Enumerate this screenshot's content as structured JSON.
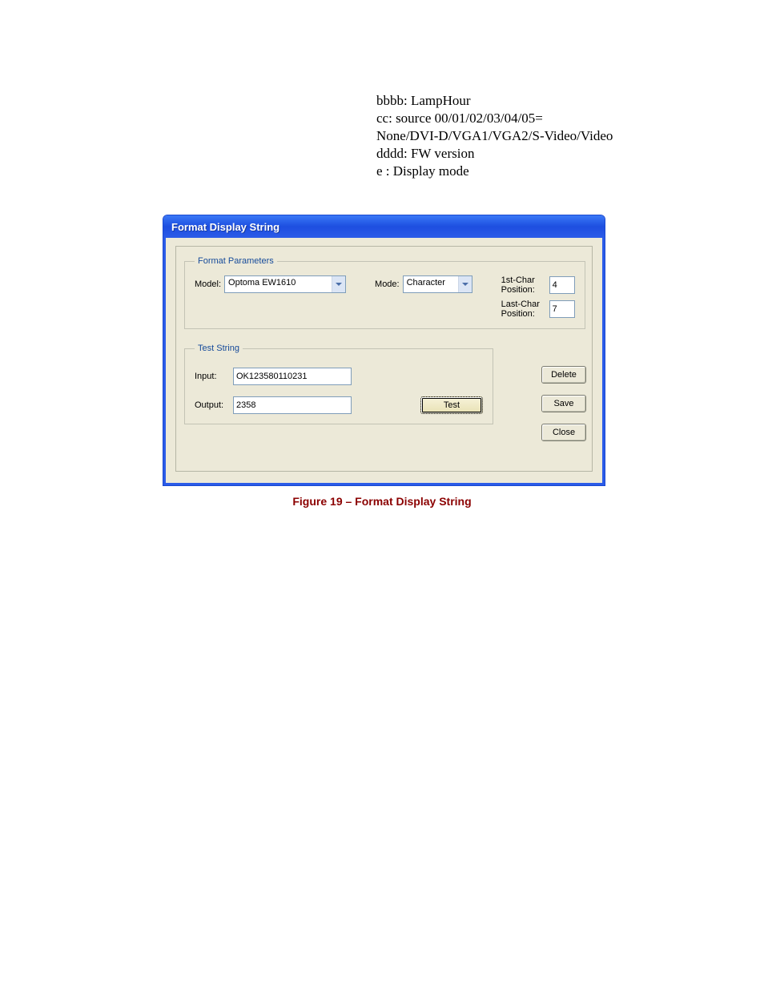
{
  "header": {
    "line1": "bbbb: LampHour",
    "line2": "cc: source 00/01/02/03/04/05=",
    "line3": "None/DVI-D/VGA1/VGA2/S-Video/Video",
    "line4": "dddd: FW version",
    "line5": "e : Display mode"
  },
  "window": {
    "title": "Format Display String"
  },
  "formatParams": {
    "legend": "Format Parameters",
    "modelLabel": "Model:",
    "modelValue": "Optoma EW1610",
    "modeLabel": "Mode:",
    "modeValue": "Character",
    "firstCharLabel": "1st-Char Position:",
    "firstCharValue": "4",
    "lastCharLabel": "Last-Char Position:",
    "lastCharValue": "7"
  },
  "testString": {
    "legend": "Test String",
    "inputLabel": "Input:",
    "inputValue": "OK123580110231",
    "outputLabel": "Output:",
    "outputValue": "2358",
    "testButton": "Test"
  },
  "buttons": {
    "delete": "Delete",
    "save": "Save",
    "close": "Close"
  },
  "caption": "Figure 19 – Format Display String"
}
